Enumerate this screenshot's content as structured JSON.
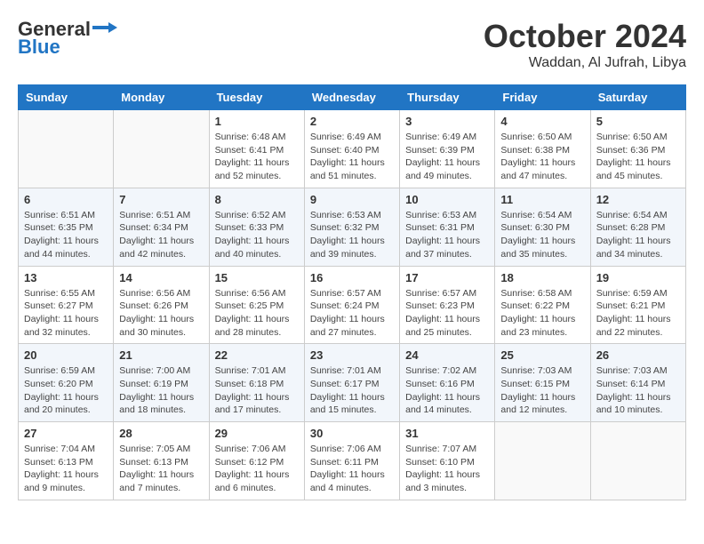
{
  "header": {
    "logo_general": "General",
    "logo_blue": "Blue",
    "month_title": "October 2024",
    "location": "Waddan, Al Jufrah, Libya"
  },
  "weekdays": [
    "Sunday",
    "Monday",
    "Tuesday",
    "Wednesday",
    "Thursday",
    "Friday",
    "Saturday"
  ],
  "weeks": [
    [
      {
        "day": "",
        "info": ""
      },
      {
        "day": "",
        "info": ""
      },
      {
        "day": "1",
        "info": "Sunrise: 6:48 AM\nSunset: 6:41 PM\nDaylight: 11 hours\nand 52 minutes."
      },
      {
        "day": "2",
        "info": "Sunrise: 6:49 AM\nSunset: 6:40 PM\nDaylight: 11 hours\nand 51 minutes."
      },
      {
        "day": "3",
        "info": "Sunrise: 6:49 AM\nSunset: 6:39 PM\nDaylight: 11 hours\nand 49 minutes."
      },
      {
        "day": "4",
        "info": "Sunrise: 6:50 AM\nSunset: 6:38 PM\nDaylight: 11 hours\nand 47 minutes."
      },
      {
        "day": "5",
        "info": "Sunrise: 6:50 AM\nSunset: 6:36 PM\nDaylight: 11 hours\nand 45 minutes."
      }
    ],
    [
      {
        "day": "6",
        "info": "Sunrise: 6:51 AM\nSunset: 6:35 PM\nDaylight: 11 hours\nand 44 minutes."
      },
      {
        "day": "7",
        "info": "Sunrise: 6:51 AM\nSunset: 6:34 PM\nDaylight: 11 hours\nand 42 minutes."
      },
      {
        "day": "8",
        "info": "Sunrise: 6:52 AM\nSunset: 6:33 PM\nDaylight: 11 hours\nand 40 minutes."
      },
      {
        "day": "9",
        "info": "Sunrise: 6:53 AM\nSunset: 6:32 PM\nDaylight: 11 hours\nand 39 minutes."
      },
      {
        "day": "10",
        "info": "Sunrise: 6:53 AM\nSunset: 6:31 PM\nDaylight: 11 hours\nand 37 minutes."
      },
      {
        "day": "11",
        "info": "Sunrise: 6:54 AM\nSunset: 6:30 PM\nDaylight: 11 hours\nand 35 minutes."
      },
      {
        "day": "12",
        "info": "Sunrise: 6:54 AM\nSunset: 6:28 PM\nDaylight: 11 hours\nand 34 minutes."
      }
    ],
    [
      {
        "day": "13",
        "info": "Sunrise: 6:55 AM\nSunset: 6:27 PM\nDaylight: 11 hours\nand 32 minutes."
      },
      {
        "day": "14",
        "info": "Sunrise: 6:56 AM\nSunset: 6:26 PM\nDaylight: 11 hours\nand 30 minutes."
      },
      {
        "day": "15",
        "info": "Sunrise: 6:56 AM\nSunset: 6:25 PM\nDaylight: 11 hours\nand 28 minutes."
      },
      {
        "day": "16",
        "info": "Sunrise: 6:57 AM\nSunset: 6:24 PM\nDaylight: 11 hours\nand 27 minutes."
      },
      {
        "day": "17",
        "info": "Sunrise: 6:57 AM\nSunset: 6:23 PM\nDaylight: 11 hours\nand 25 minutes."
      },
      {
        "day": "18",
        "info": "Sunrise: 6:58 AM\nSunset: 6:22 PM\nDaylight: 11 hours\nand 23 minutes."
      },
      {
        "day": "19",
        "info": "Sunrise: 6:59 AM\nSunset: 6:21 PM\nDaylight: 11 hours\nand 22 minutes."
      }
    ],
    [
      {
        "day": "20",
        "info": "Sunrise: 6:59 AM\nSunset: 6:20 PM\nDaylight: 11 hours\nand 20 minutes."
      },
      {
        "day": "21",
        "info": "Sunrise: 7:00 AM\nSunset: 6:19 PM\nDaylight: 11 hours\nand 18 minutes."
      },
      {
        "day": "22",
        "info": "Sunrise: 7:01 AM\nSunset: 6:18 PM\nDaylight: 11 hours\nand 17 minutes."
      },
      {
        "day": "23",
        "info": "Sunrise: 7:01 AM\nSunset: 6:17 PM\nDaylight: 11 hours\nand 15 minutes."
      },
      {
        "day": "24",
        "info": "Sunrise: 7:02 AM\nSunset: 6:16 PM\nDaylight: 11 hours\nand 14 minutes."
      },
      {
        "day": "25",
        "info": "Sunrise: 7:03 AM\nSunset: 6:15 PM\nDaylight: 11 hours\nand 12 minutes."
      },
      {
        "day": "26",
        "info": "Sunrise: 7:03 AM\nSunset: 6:14 PM\nDaylight: 11 hours\nand 10 minutes."
      }
    ],
    [
      {
        "day": "27",
        "info": "Sunrise: 7:04 AM\nSunset: 6:13 PM\nDaylight: 11 hours\nand 9 minutes."
      },
      {
        "day": "28",
        "info": "Sunrise: 7:05 AM\nSunset: 6:13 PM\nDaylight: 11 hours\nand 7 minutes."
      },
      {
        "day": "29",
        "info": "Sunrise: 7:06 AM\nSunset: 6:12 PM\nDaylight: 11 hours\nand 6 minutes."
      },
      {
        "day": "30",
        "info": "Sunrise: 7:06 AM\nSunset: 6:11 PM\nDaylight: 11 hours\nand 4 minutes."
      },
      {
        "day": "31",
        "info": "Sunrise: 7:07 AM\nSunset: 6:10 PM\nDaylight: 11 hours\nand 3 minutes."
      },
      {
        "day": "",
        "info": ""
      },
      {
        "day": "",
        "info": ""
      }
    ]
  ]
}
